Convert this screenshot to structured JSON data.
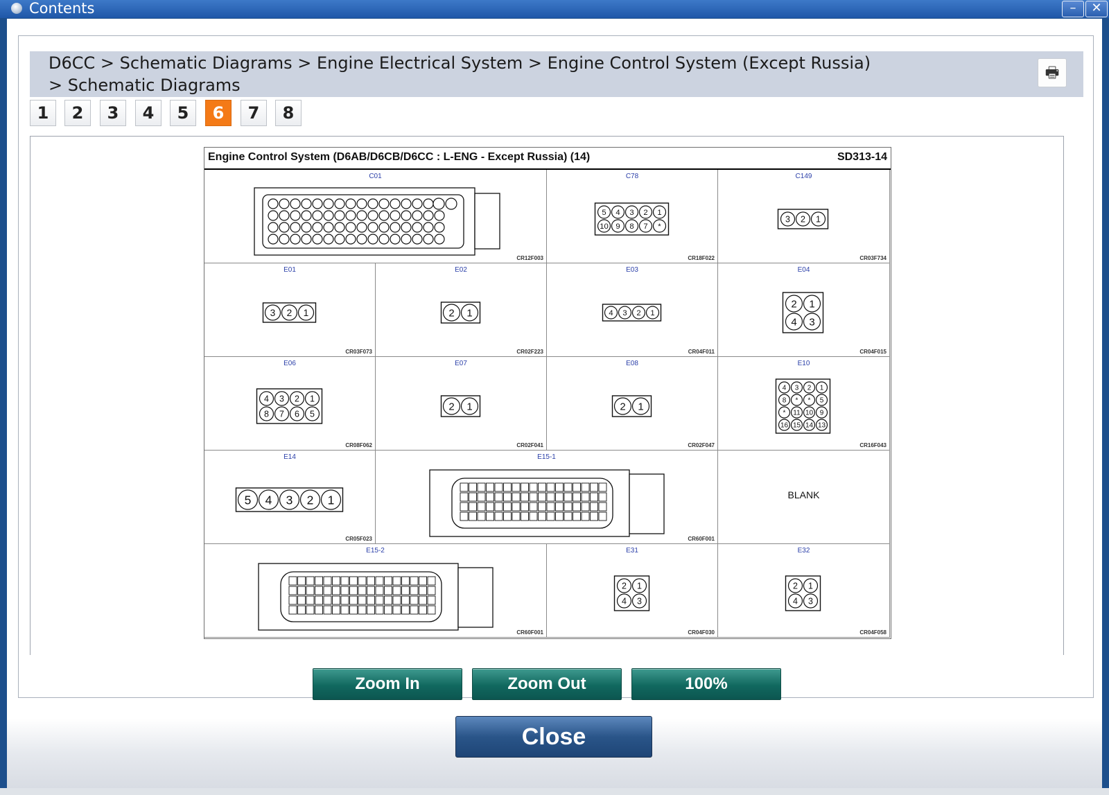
{
  "window": {
    "title": "Contents",
    "minimize_label": "–",
    "close_label": "✕"
  },
  "breadcrumb": {
    "text": "D6CC > Schematic Diagrams > Engine Electrical System > Engine Control System (Except Russia) > Schematic Diagrams"
  },
  "toolbar": {
    "print_icon": "printer-icon"
  },
  "pages": [
    "1",
    "2",
    "3",
    "4",
    "5",
    "6",
    "7",
    "8"
  ],
  "active_page": "6",
  "diagram": {
    "title": "Engine Control System (D6AB/D6CB/D6CC : L-ENG - Except Russia) (14)",
    "code": "SD313-14",
    "cells": [
      {
        "label": "C01",
        "code": "CR12F003"
      },
      {
        "label": "C78",
        "code": "CR18F022"
      },
      {
        "label": "C149",
        "code": "CR03F734"
      },
      {
        "label": "E01",
        "code": "CR03F073"
      },
      {
        "label": "E02",
        "code": "CR02F223"
      },
      {
        "label": "E03",
        "code": "CR04F011"
      },
      {
        "label": "E04",
        "code": "CR04F015"
      },
      {
        "label": "E06",
        "code": "CR08F062"
      },
      {
        "label": "E07",
        "code": "CR02F041"
      },
      {
        "label": "E08",
        "code": "CR02F047"
      },
      {
        "label": "E10",
        "code": "CR16F043"
      },
      {
        "label": "E14",
        "code": "CR05F023"
      },
      {
        "label": "E15-1",
        "code": "CR60F001"
      },
      {
        "label": "",
        "code": "",
        "blank": "BLANK"
      },
      {
        "label": "E15-2",
        "code": "CR60F001"
      },
      {
        "label": "E31",
        "code": "CR04F030"
      },
      {
        "label": "E32",
        "code": "CR04F058"
      }
    ]
  },
  "buttons": {
    "zoom_in": "Zoom In",
    "zoom_out": "Zoom Out",
    "reset": "100%",
    "close": "Close"
  }
}
